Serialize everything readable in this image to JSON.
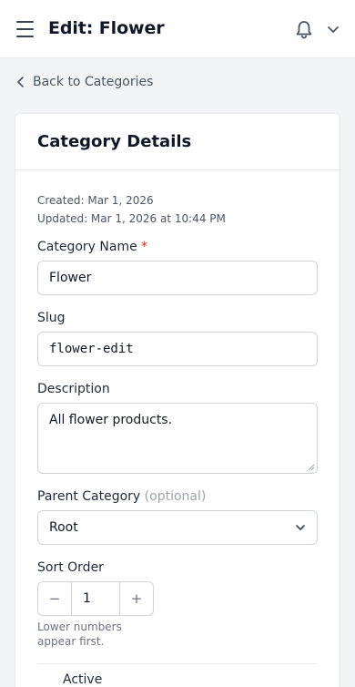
{
  "header": {
    "title": "Edit: Flower",
    "menu_icon": "hamburger-menu-icon",
    "bell_icon": "bell-icon",
    "dropdown_icon": "chevron-down-icon"
  },
  "back_link": {
    "label": "Back to Categories",
    "icon": "chevron-left-icon"
  },
  "card": {
    "title": "Category Details",
    "created": "Created: Mar 1, 2026",
    "updated": "Updated: Mar 1, 2026 at 10:44 PM",
    "fields": {
      "name": {
        "label": "Category Name",
        "required_mark": "*",
        "value": "Flower"
      },
      "slug": {
        "label": "Slug",
        "value": "flower-edit"
      },
      "description": {
        "label": "Description",
        "value": "All flower products."
      },
      "parent": {
        "label": "Parent Category",
        "optional": "(optional)",
        "value": "Root"
      },
      "sort_order": {
        "label": "Sort Order",
        "value": "1",
        "decrement": "−",
        "increment": "+",
        "hint": "Lower numbers appear first."
      },
      "active": {
        "label": "Active"
      }
    }
  },
  "colors": {
    "background": "#f3f4f6",
    "card": "#ffffff",
    "border": "#d1d5db",
    "required": "#dc2626",
    "text": "#1f2937",
    "muted": "#6b7280"
  }
}
